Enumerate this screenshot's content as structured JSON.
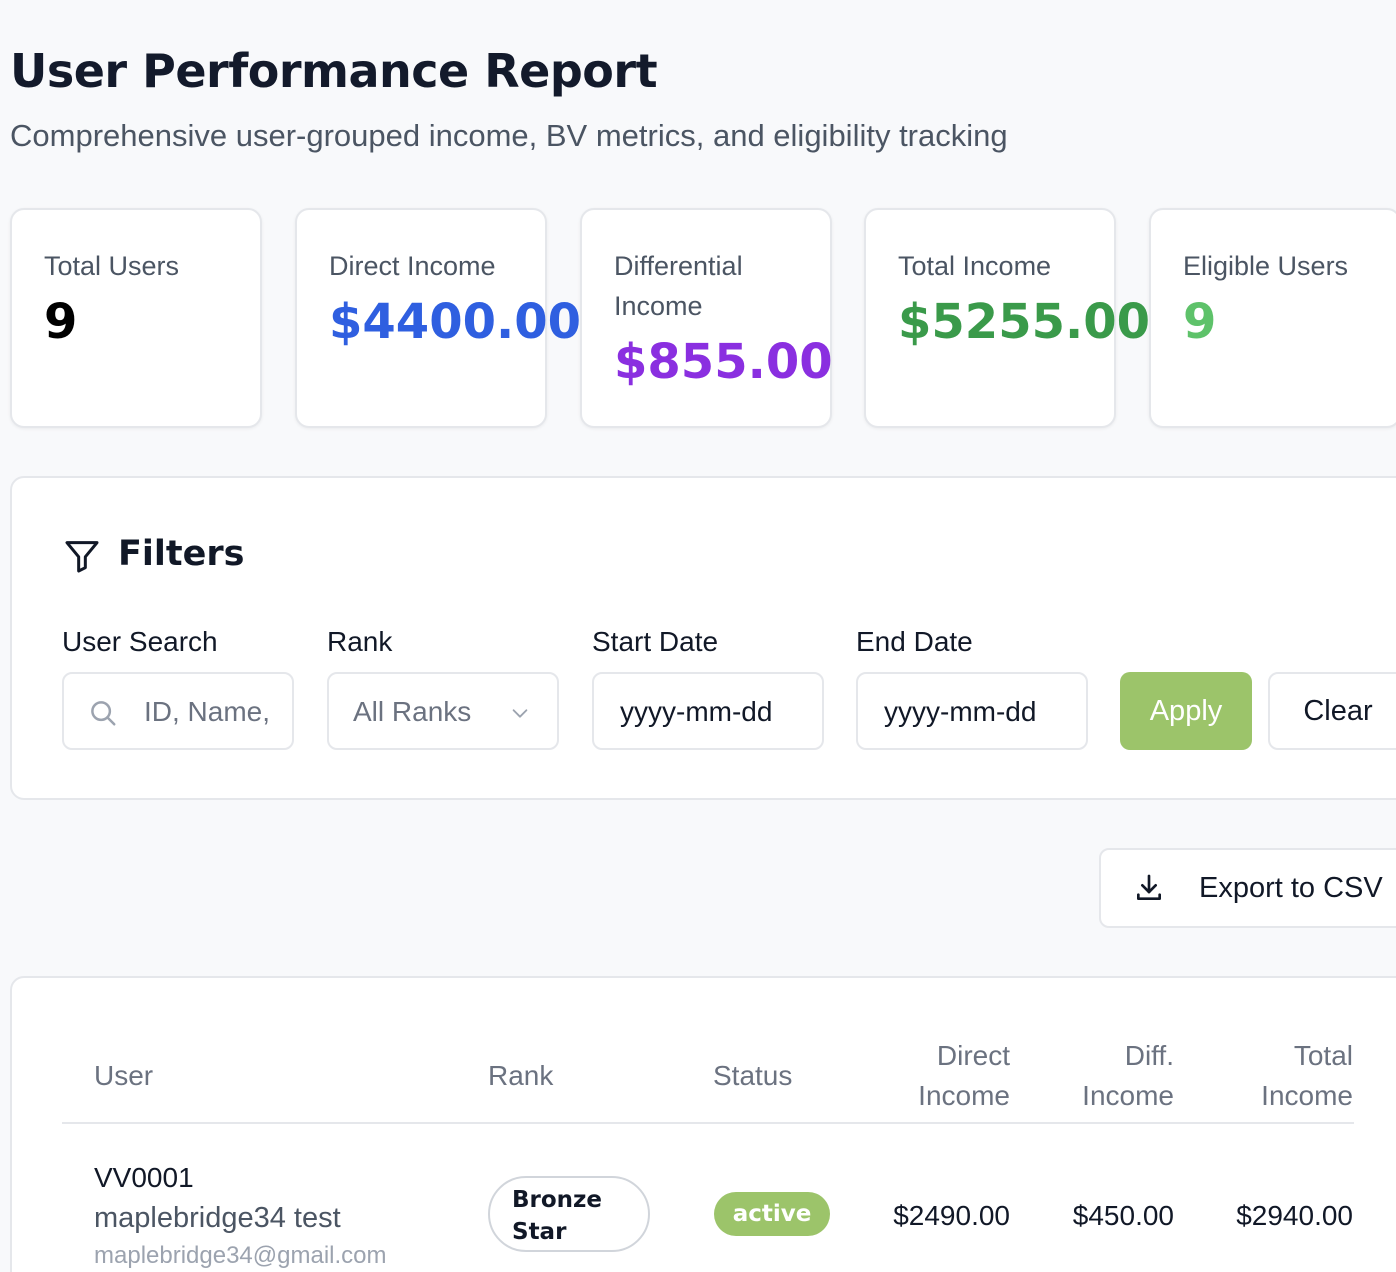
{
  "header": {
    "title": "User Performance Report",
    "subtitle": "Comprehensive user-grouped income, BV metrics, and eligibility tracking"
  },
  "stats": [
    {
      "label": "Total Users",
      "value": "9",
      "color": "#000000"
    },
    {
      "label": "Direct Income",
      "value": "$4400.00",
      "color": "#2f5fe0"
    },
    {
      "label": "Differential Income",
      "value": "$855.00",
      "color": "#8a2fe0"
    },
    {
      "label": "Total Income",
      "value": "$5255.00",
      "color": "#3a9a4a"
    },
    {
      "label": "Eligible Users",
      "value": "9",
      "color": "#5ec26a"
    }
  ],
  "filters": {
    "title": "Filters",
    "user_search": {
      "label": "User Search",
      "placeholder": "ID, Name,"
    },
    "rank": {
      "label": "Rank",
      "selected": "All Ranks"
    },
    "start_date": {
      "label": "Start Date",
      "value": "yyyy-mm-dd"
    },
    "end_date": {
      "label": "End Date",
      "value": "yyyy-mm-dd"
    },
    "apply_label": "Apply",
    "clear_label": "Clear"
  },
  "export": {
    "label": "Export to CSV",
    "icon": "download-icon"
  },
  "table": {
    "headers": {
      "user": "User",
      "rank": "Rank",
      "status": "Status",
      "direct_1": "Direct",
      "direct_2": "Income",
      "diff_1": "Diff.",
      "diff_2": "Income",
      "total_1": "Total",
      "total_2": "Income"
    },
    "rows": [
      {
        "id": "VV0001",
        "name": "maplebridge34 test",
        "email": "maplebridge34@gmail.com",
        "rank_1": "Bronze",
        "rank_2": "Star",
        "status": "active",
        "direct_income": "$2490.00",
        "diff_income": "$450.00",
        "total_income": "$2940.00"
      }
    ]
  },
  "colors": {
    "accent_green": "#9cc46a",
    "border": "#e5e7eb"
  }
}
